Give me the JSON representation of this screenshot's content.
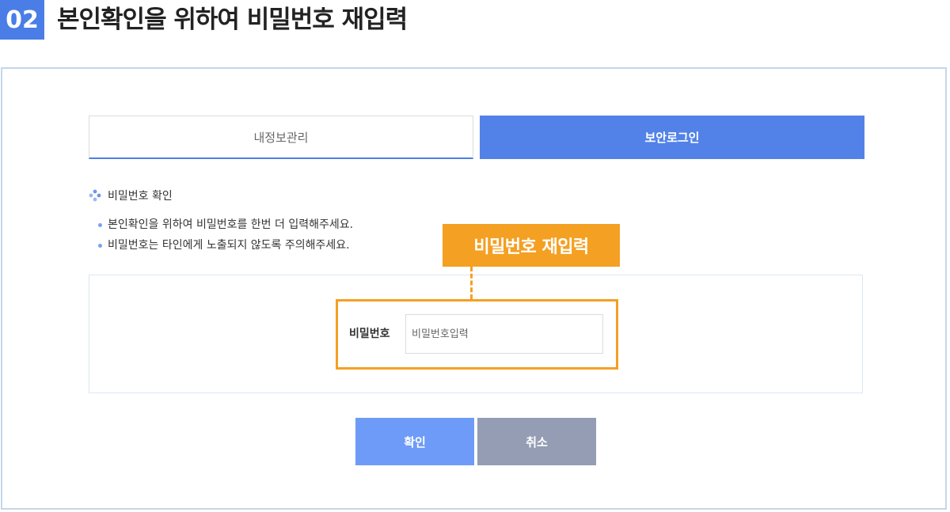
{
  "header": {
    "step_number": "02",
    "title": "본인확인을 위하여 비밀번호 재입력"
  },
  "tabs": [
    {
      "label": "내정보관리",
      "active": false
    },
    {
      "label": "보안로그인",
      "active": true
    }
  ],
  "section": {
    "title": "비밀번호 확인",
    "icon": "diamond-dots-icon",
    "notes": [
      "본인확인을 위하여 비밀번호를 한번 더 입력해주세요.",
      "비밀번호는 타인에게 노출되지 않도록 주의해주세요."
    ]
  },
  "form": {
    "label": "비밀번호",
    "value": "",
    "placeholder": "비밀번호입력"
  },
  "callout": {
    "label": "비밀번호 재입력"
  },
  "buttons": {
    "confirm": "확인",
    "cancel": "취소"
  },
  "colors": {
    "accent": "#4a7de6",
    "active_tab": "#5282e8",
    "callout": "#f4a023",
    "confirm_button": "#6d9bf7",
    "cancel_button": "#949db4",
    "panel_border": "#c5d6ea"
  }
}
